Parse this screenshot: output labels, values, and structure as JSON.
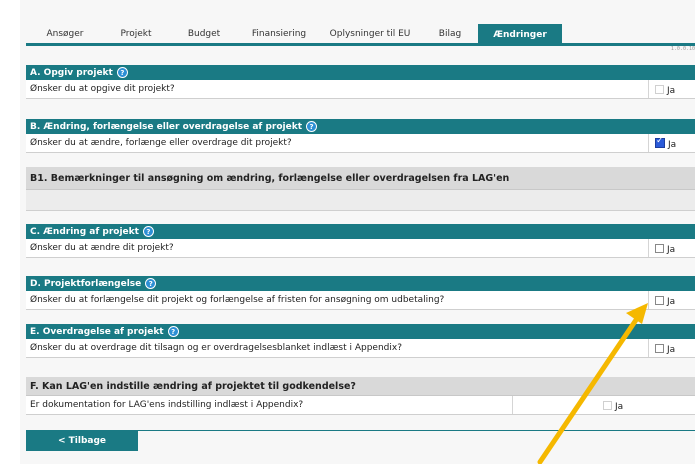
{
  "tabs": [
    "Ansøger",
    "Projekt",
    "Budget",
    "Finansiering",
    "Oplysninger til EU",
    "Bilag",
    "Ændringer"
  ],
  "active_tab": "Ændringer",
  "version": "1.0.0.10",
  "sections": {
    "a": {
      "title": "A. Opgiv projekt",
      "question": "Ønsker du at opgive dit projekt?",
      "answer": "Ja",
      "checked": false
    },
    "b": {
      "title": "B. Ændring, forlængelse eller overdragelse af projekt",
      "question": "Ønsker du at ændre, forlænge eller overdrage dit projekt?",
      "answer": "Ja",
      "checked": true
    },
    "b1": {
      "title": "B1. Bemærkninger til ansøgning om ændring, forlængelse eller overdragelsen fra LAG'en"
    },
    "c": {
      "title": "C. Ændring af projekt",
      "question": "Ønsker du at ændre dit projekt?",
      "answer": "Ja",
      "checked": false
    },
    "d": {
      "title": "D. Projektforlængelse",
      "question": "Ønsker du at forlængelse dit projekt og forlængelse af fristen for ansøgning om udbetaling?",
      "answer": "Ja",
      "checked": false
    },
    "e": {
      "title": "E. Overdragelse af projekt",
      "question": "Ønsker du at overdrage dit tilsagn og er overdragelsesblanket indlæst i Appendix?",
      "answer": "Ja",
      "checked": false
    },
    "f": {
      "title": "F. Kan LAG'en indstille ændring af projektet til godkendelse?",
      "question": "Er dokumentation for LAG'ens indstilling indlæst i Appendix?",
      "answer": "Ja",
      "checked": false
    }
  },
  "help_glyph": "?",
  "back_button": "< Tilbage",
  "colors": {
    "header": "#1a7a84",
    "accent_arrow": "#f5b800",
    "checkbox_checked": "#2a5ad8"
  }
}
